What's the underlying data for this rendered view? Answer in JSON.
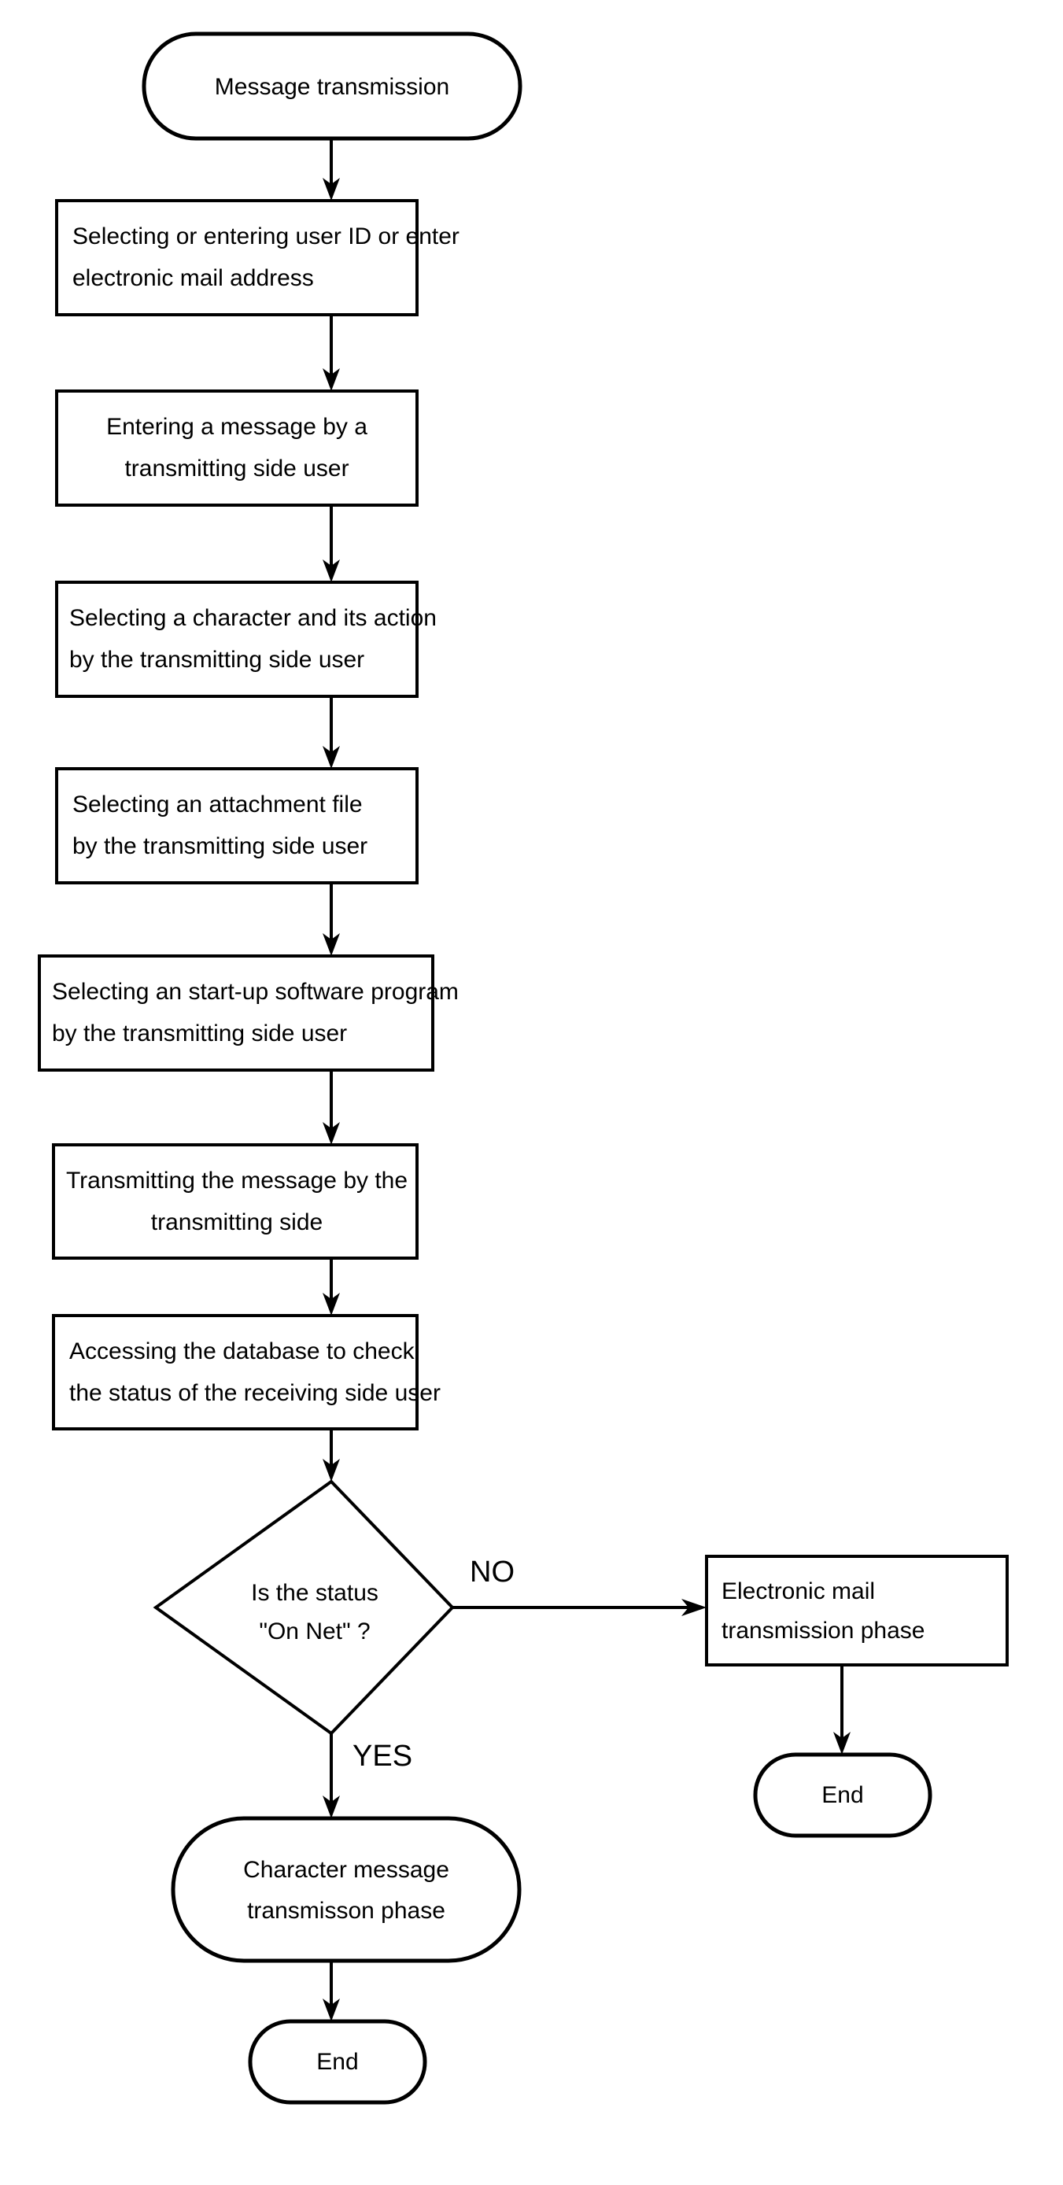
{
  "diagram": {
    "type": "flowchart",
    "title": "Message transmission",
    "orientation": "top-to-bottom",
    "background_color": "#ffffff",
    "line_color": "#000000",
    "nodes": {
      "start": {
        "shape": "terminator",
        "label": "Message transmission"
      },
      "step1": {
        "shape": "process",
        "line1": "Selecting or entering user ID or enter",
        "line2": "electronic mail address"
      },
      "step2": {
        "shape": "process",
        "line1": "Entering a message by a",
        "line2": "transmitting side user"
      },
      "step3": {
        "shape": "process",
        "line1": "Selecting a character and its action",
        "line2": "by the transmitting side user"
      },
      "step4": {
        "shape": "process",
        "line1": "Selecting an attachment file",
        "line2": "by the transmitting side user"
      },
      "step5": {
        "shape": "process",
        "line1": "Selecting an start-up software program",
        "line2": "by the transmitting side user"
      },
      "step6": {
        "shape": "process",
        "line1": "Transmitting the message by the",
        "line2": "transmitting side"
      },
      "step7": {
        "shape": "process",
        "line1": "Accessing the database to check",
        "line2": "the status of the receiving side user"
      },
      "decision": {
        "shape": "diamond",
        "line1": "Is the status",
        "line2": "\"On Net\" ?"
      },
      "email_phase": {
        "shape": "process",
        "line1": "Electronic mail",
        "line2": "transmission phase"
      },
      "end_right": {
        "shape": "terminator",
        "label": "End"
      },
      "character_phase": {
        "shape": "terminator",
        "line1": "Character message",
        "line2": "transmisson phase"
      },
      "end_left": {
        "shape": "terminator",
        "label": "End"
      }
    },
    "branch_labels": {
      "no": "NO",
      "yes": "YES"
    }
  }
}
